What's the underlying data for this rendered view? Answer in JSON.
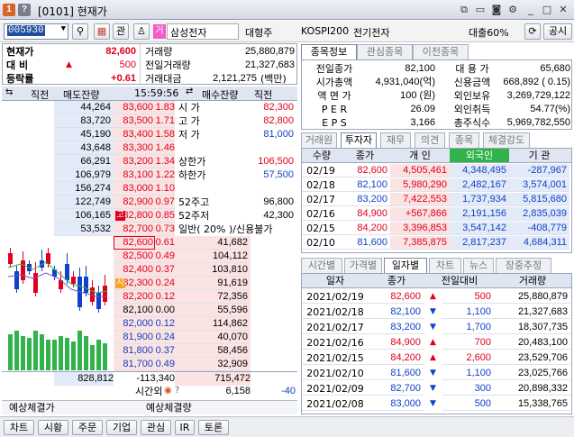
{
  "titlebar": {
    "badge1": "1",
    "badge2": "?",
    "title": "[0101] 현재가",
    "icons": [
      "new-window-icon",
      "restore-icon",
      "camera-icon",
      "gear-icon",
      "close-icon"
    ]
  },
  "toolbar": {
    "code": "005930",
    "search": "⚲",
    "gwan": "관",
    "mode": "거",
    "name": "삼성전자",
    "grade": "대형주",
    "index": "KOSPI200",
    "sector": "전기전자",
    "loan": "대출60%",
    "gongsi": "공시"
  },
  "price": {
    "lbl_cur": "현재가",
    "cur": "82,600",
    "lbl_diff": "대 비",
    "diff_arrow": "▲",
    "diff": "500",
    "lbl_rate": "등락률",
    "rate": "+0.61",
    "lbl_vol": "거래량",
    "vol": "25,880,879",
    "lbl_prevvol": "전일거래량",
    "prevvol": "21,327,683",
    "lbl_amt": "거래대금",
    "amt": "2,121,275",
    "amt_unit": "(백만)"
  },
  "orderbook": {
    "hdr": {
      "chg": "직전",
      "ask": "매도잔량",
      "time": "15:59:56",
      "bid": "매수잔량",
      "chg2": "직전"
    },
    "asks": [
      {
        "qty": "44,264",
        "price": "83,600",
        "rate": "1.83"
      },
      {
        "qty": "83,720",
        "price": "83,500",
        "rate": "1.71"
      },
      {
        "qty": "45,190",
        "price": "83,400",
        "rate": "1.58"
      },
      {
        "qty": "43,648",
        "price": "83,300",
        "rate": "1.46"
      },
      {
        "qty": "66,291",
        "price": "83,200",
        "rate": "1.34"
      },
      {
        "qty": "106,979",
        "price": "83,100",
        "rate": "1.22"
      },
      {
        "qty": "156,274",
        "price": "83,000",
        "rate": "1.10"
      },
      {
        "qty": "122,749",
        "price": "82,900",
        "rate": "0.97"
      },
      {
        "qty": "106,165",
        "price": "82,800",
        "rate": "0.85",
        "mark": "고"
      },
      {
        "qty": "53,532",
        "price": "82,700",
        "rate": "0.73"
      }
    ],
    "ask_side": [
      {
        "label": "시 가",
        "value": "82,300",
        "color": "red"
      },
      {
        "label": "고 가",
        "value": "82,800",
        "color": "red"
      },
      {
        "label": "저 가",
        "value": "81,000",
        "color": "blue"
      },
      {
        "label": "",
        "value": "",
        "color": ""
      },
      {
        "label": "상한가",
        "value": "106,500",
        "color": "red"
      },
      {
        "label": "하한가",
        "value": "57,500",
        "color": "blue"
      },
      {
        "label": "",
        "value": "",
        "color": ""
      },
      {
        "label": "52주고",
        "value": "96,800",
        "color": ""
      },
      {
        "label": "52주저",
        "value": "42,300",
        "color": ""
      },
      {
        "label": "일반( 20% )/신용불가",
        "value": "",
        "color": ""
      }
    ],
    "bids": [
      {
        "price": "82,600",
        "rate": "0.61",
        "qty": "41,682",
        "cur": true
      },
      {
        "price": "82,500",
        "rate": "0.49",
        "qty": "104,112"
      },
      {
        "price": "82,400",
        "rate": "0.37",
        "qty": "103,810"
      },
      {
        "price": "82,300",
        "rate": "0.24",
        "qty": "91,619",
        "mark": "시"
      },
      {
        "price": "82,200",
        "rate": "0.12",
        "qty": "72,356"
      },
      {
        "price": "82,100",
        "rate": "0.00",
        "qty": "55,596"
      },
      {
        "price": "82,000",
        "rate": "0.12",
        "qty": "114,862"
      },
      {
        "price": "81,900",
        "rate": "0.24",
        "qty": "40,070"
      },
      {
        "price": "81,800",
        "rate": "0.37",
        "qty": "58,456"
      },
      {
        "price": "81,700",
        "rate": "0.49",
        "qty": "32,909"
      }
    ],
    "total_ask": "828,812",
    "total_diff": "-113,340",
    "total_bid": "715,472",
    "after_lbl": "시간외",
    "after_qty": "6,158",
    "after_diff": "-40",
    "exp_lbl": "예상체결가",
    "exp_lbl2": "예상체결량"
  },
  "info": {
    "tabs": [
      "종목정보",
      "관심종목",
      "이전종목"
    ],
    "rows": [
      {
        "l": "전일종가",
        "v": "82,100",
        "l2": "대 용 가",
        "v2": "65,680"
      },
      {
        "l": "시가총액",
        "v": "4,931,040(억)",
        "l2": "신용금액",
        "v2": "668,892 ( 0.15)"
      },
      {
        "l": "액 면 가",
        "v": "100 (원)",
        "l2": "외인보유",
        "v2": "3,269,729,122"
      },
      {
        "l": "P E R",
        "v": "26.09",
        "l2": "외인취득",
        "v2": "54.77(%)"
      },
      {
        "l": "E P S",
        "v": "3,166",
        "l2": "총주식수",
        "v2": "5,969,782,550"
      }
    ]
  },
  "investor": {
    "tabs": [
      "거래원",
      "투자자",
      "재무",
      "의견",
      "종목",
      "체결강도"
    ],
    "headers": [
      "수량",
      "종가",
      "개 인",
      "외국인",
      "기 관"
    ],
    "rows": [
      {
        "d": "02/19",
        "p": "82,600",
        "a": "4,505,461",
        "b": "4,348,495",
        "c": "-287,967",
        "pc": "red"
      },
      {
        "d": "02/18",
        "p": "82,100",
        "a": "5,980,290",
        "b": "2,482,167",
        "c": "3,574,001",
        "pc": "blue"
      },
      {
        "d": "02/17",
        "p": "83,200",
        "a": "7,422,553",
        "b": "1,737,934",
        "c": "5,815,680",
        "pc": "blue"
      },
      {
        "d": "02/16",
        "p": "84,900",
        "a": "+567,866",
        "b": "2,191,156",
        "c": "2,835,039",
        "pc": "red"
      },
      {
        "d": "02/15",
        "p": "84,200",
        "a": "3,396,853",
        "b": "3,547,142",
        "c": "-408,779",
        "pc": "red"
      },
      {
        "d": "02/10",
        "p": "81,600",
        "a": "7,385,875",
        "b": "2,817,237",
        "c": "4,684,311",
        "pc": "blue"
      }
    ]
  },
  "daily": {
    "tabs": [
      "시간별",
      "가격별",
      "일자별",
      "차트",
      "뉴스",
      "장중추정"
    ],
    "headers": [
      "일자",
      "종가",
      "전일대비",
      "거래량"
    ],
    "rows": [
      {
        "d": "2021/02/19",
        "p": "82,600",
        "dir": "▲",
        "diff": "500",
        "v": "25,880,879",
        "pc": "red"
      },
      {
        "d": "2021/02/18",
        "p": "82,100",
        "dir": "▼",
        "diff": "1,100",
        "v": "21,327,683",
        "pc": "blue"
      },
      {
        "d": "2021/02/17",
        "p": "83,200",
        "dir": "▼",
        "diff": "1,700",
        "v": "18,307,735",
        "pc": "blue"
      },
      {
        "d": "2021/02/16",
        "p": "84,900",
        "dir": "▲",
        "diff": "700",
        "v": "20,483,100",
        "pc": "red"
      },
      {
        "d": "2021/02/15",
        "p": "84,200",
        "dir": "▲",
        "diff": "2,600",
        "v": "23,529,706",
        "pc": "red"
      },
      {
        "d": "2021/02/10",
        "p": "81,600",
        "dir": "▼",
        "diff": "1,100",
        "v": "23,025,766",
        "pc": "blue"
      },
      {
        "d": "2021/02/09",
        "p": "82,700",
        "dir": "▼",
        "diff": "300",
        "v": "20,898,332",
        "pc": "blue"
      },
      {
        "d": "2021/02/08",
        "p": "83,000",
        "dir": "▼",
        "diff": "500",
        "v": "15,338,765",
        "pc": "blue"
      }
    ]
  },
  "bottom": {
    "buttons": [
      "차트",
      "시황",
      "주문",
      "기업",
      "관심",
      "IR",
      "토론"
    ]
  },
  "colors": {
    "up": "#e0001b",
    "down": "#1141c8",
    "ask_bg": "#e3ebf8",
    "bid_bg": "#fbe3e3",
    "volume_bar": "#2fb34a"
  }
}
